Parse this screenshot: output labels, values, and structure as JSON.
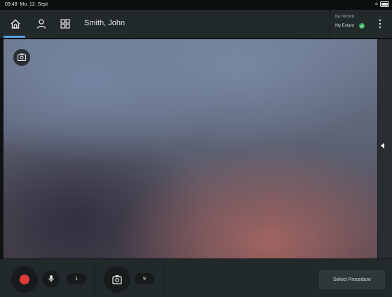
{
  "status_bar": {
    "time": "09:48",
    "date": "Mo. 12. Sept"
  },
  "header": {
    "patient_name": "Smith, John",
    "network_label": "NETWORK",
    "network_value": "My Extaro"
  },
  "icons": {
    "home": "home-icon",
    "user": "user-icon",
    "apps": "grid-icon",
    "more": "more-vertical-icon",
    "snapshot": "screenshot-icon",
    "record": "record-icon",
    "mic": "microphone-icon",
    "camera": "camera-icon",
    "network_status": "check-circle-icon"
  },
  "footer": {
    "audio_count": "1",
    "photo_count": "9",
    "select_procedure_label": "Select Procedure"
  },
  "colors": {
    "accent": "#5aa0e0",
    "record": "#e53935",
    "connected": "#2fae5b",
    "bar_bg": "#22292b"
  }
}
